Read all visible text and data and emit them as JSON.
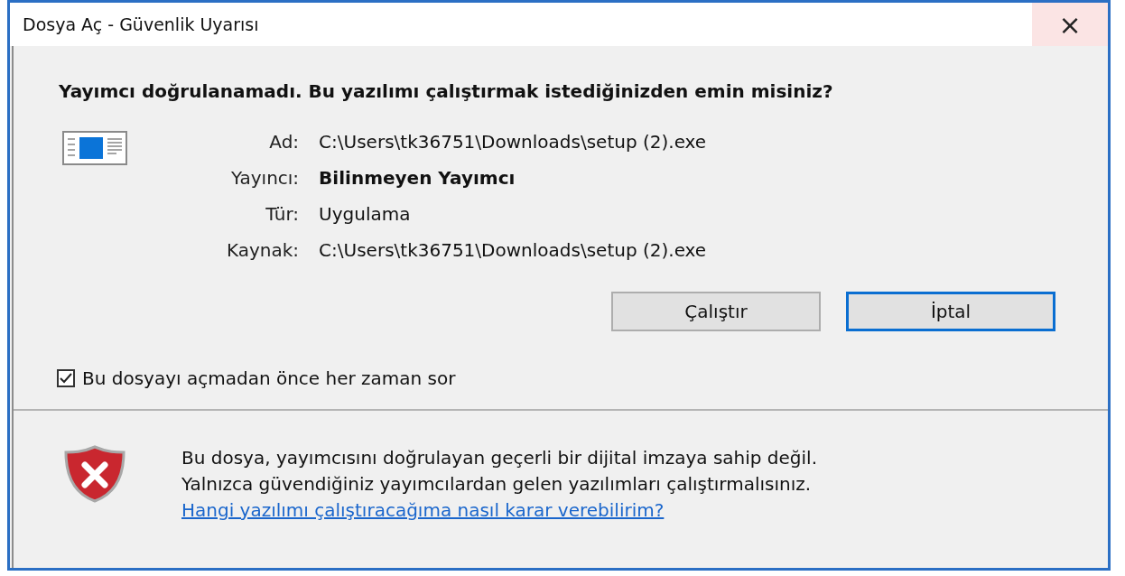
{
  "window": {
    "title": "Dosya Aç - Güvenlik Uyarısı",
    "close": "×"
  },
  "heading": "Yayımcı doğrulanamadı. Bu yazılımı çalıştırmak istediğinizden emin misiniz?",
  "details": [
    {
      "label": "Ad:",
      "value": "C:\\Users\\tk36751\\Downloads\\setup (2).exe",
      "emphasis": false
    },
    {
      "label": "Yayıncı:",
      "value": "Bilinmeyen Yayımcı",
      "emphasis": true
    },
    {
      "label": "Tür:",
      "value": "Uygulama",
      "emphasis": false
    },
    {
      "label": "Kaynak:",
      "value": "C:\\Users\\tk36751\\Downloads\\setup (2).exe",
      "emphasis": false
    }
  ],
  "buttons": [
    {
      "label": "Çalıştır",
      "default": false
    },
    {
      "label": "İptal",
      "default": true
    }
  ],
  "checkbox": {
    "label": "Bu dosyayı açmadan önce her zaman sor",
    "checked": true
  },
  "warning": {
    "lines": [
      "Bu dosya, yayımcısını doğrulayan geçerli bir dijital imzaya sahip değil.",
      "Yalnızca güvendiğiniz yayımcılardan gelen yazılımları çalıştırmalısınız."
    ],
    "link": "Hangi yazılımı çalıştıracağıma nasıl karar verebilirim?"
  }
}
